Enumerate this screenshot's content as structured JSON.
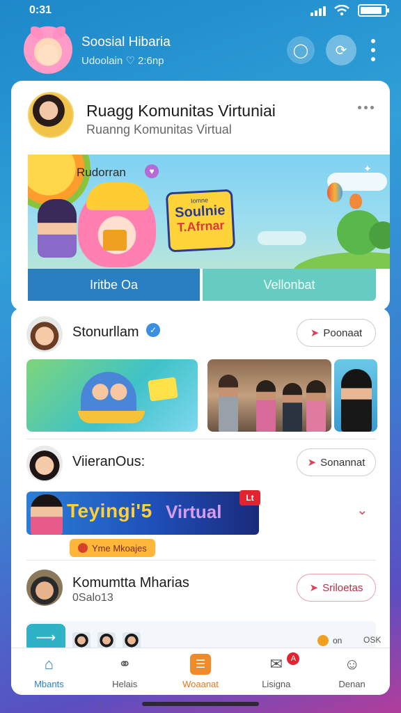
{
  "status_bar": {
    "time": "0:31"
  },
  "header": {
    "title": "Soosial Hibaria",
    "subtitle": "Udoolain ♡ 2:6np"
  },
  "community": {
    "title": "Ruagg Komunitas Virtuniai",
    "subtitle": "Ruanng Komunitas Virtual"
  },
  "banner": {
    "label": "Rudorran",
    "game_logo": {
      "line1": "Iomne",
      "line2": "Soulnie",
      "line3": "T.Afrnar"
    },
    "tabs": [
      {
        "label": "Iritbe Oa",
        "active": true
      },
      {
        "label": "Vellonbat",
        "active": false
      }
    ]
  },
  "posts": [
    {
      "name": "Stonurllam",
      "verified": true,
      "action": "Poonaat"
    },
    {
      "name": "ViieranOus:",
      "action": "Sonannat",
      "banner_title": "Teyingi'5",
      "banner_title2": "Virtual",
      "badge": "Lt",
      "tag": "Yme Mkoajes"
    },
    {
      "name": "Komumtta Mharias",
      "meta": "0Salo13",
      "action": "Sriloetas"
    }
  ],
  "mini_row": {
    "stat_value": "on",
    "stat_right": "OSK"
  },
  "bottom_nav": [
    {
      "label": "Mbants",
      "icon": "home-icon",
      "active": true
    },
    {
      "label": "Helais",
      "icon": "chat-search-icon",
      "active": false
    },
    {
      "label": "Woaanat",
      "icon": "create-icon",
      "active": false
    },
    {
      "label": "Lisigna",
      "icon": "notifications-icon",
      "active": false,
      "badge": "A"
    },
    {
      "label": "Denan",
      "icon": "profile-icon",
      "active": false
    }
  ]
}
